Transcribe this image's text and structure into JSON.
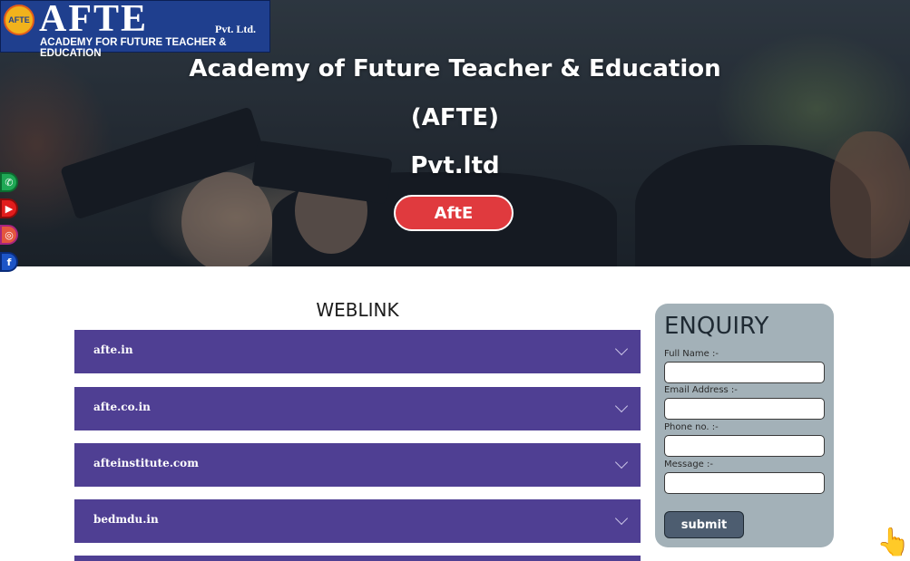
{
  "logo": {
    "badge": "AFTE",
    "main": "AFTE",
    "suffix": "Pvt. Ltd.",
    "tagline": "ACADEMY FOR FUTURE TEACHER & EDUCATION"
  },
  "hero": {
    "line1": "Academy of Future Teacher & Education",
    "line2": "(AFTE)",
    "line3": "Pvt.ltd",
    "button_label": "AftE",
    "button_color": "#e03a3e"
  },
  "social": [
    {
      "icon": "whatsapp-icon",
      "glyph": "✆"
    },
    {
      "icon": "youtube-icon",
      "glyph": "▶"
    },
    {
      "icon": "instagram-icon",
      "glyph": "◎"
    },
    {
      "icon": "facebook-icon",
      "glyph": "f"
    }
  ],
  "weblink": {
    "heading": "WEBLINK",
    "items": [
      {
        "label": "afte.in"
      },
      {
        "label": "afte.co.in"
      },
      {
        "label": "afteinstitute.com"
      },
      {
        "label": "bedmdu.in"
      }
    ],
    "accent": "#4f3f93"
  },
  "enquiry": {
    "title": "ENQUIRY",
    "fields": [
      {
        "label": "Full Name :-",
        "value": ""
      },
      {
        "label": "Email Address :-",
        "value": ""
      },
      {
        "label": "Phone no. :-",
        "value": ""
      },
      {
        "label": "Message :-",
        "value": ""
      }
    ],
    "submit_label": "submit"
  },
  "cursor": {
    "icon": "pointer-hand-icon",
    "glyph": "👆"
  }
}
